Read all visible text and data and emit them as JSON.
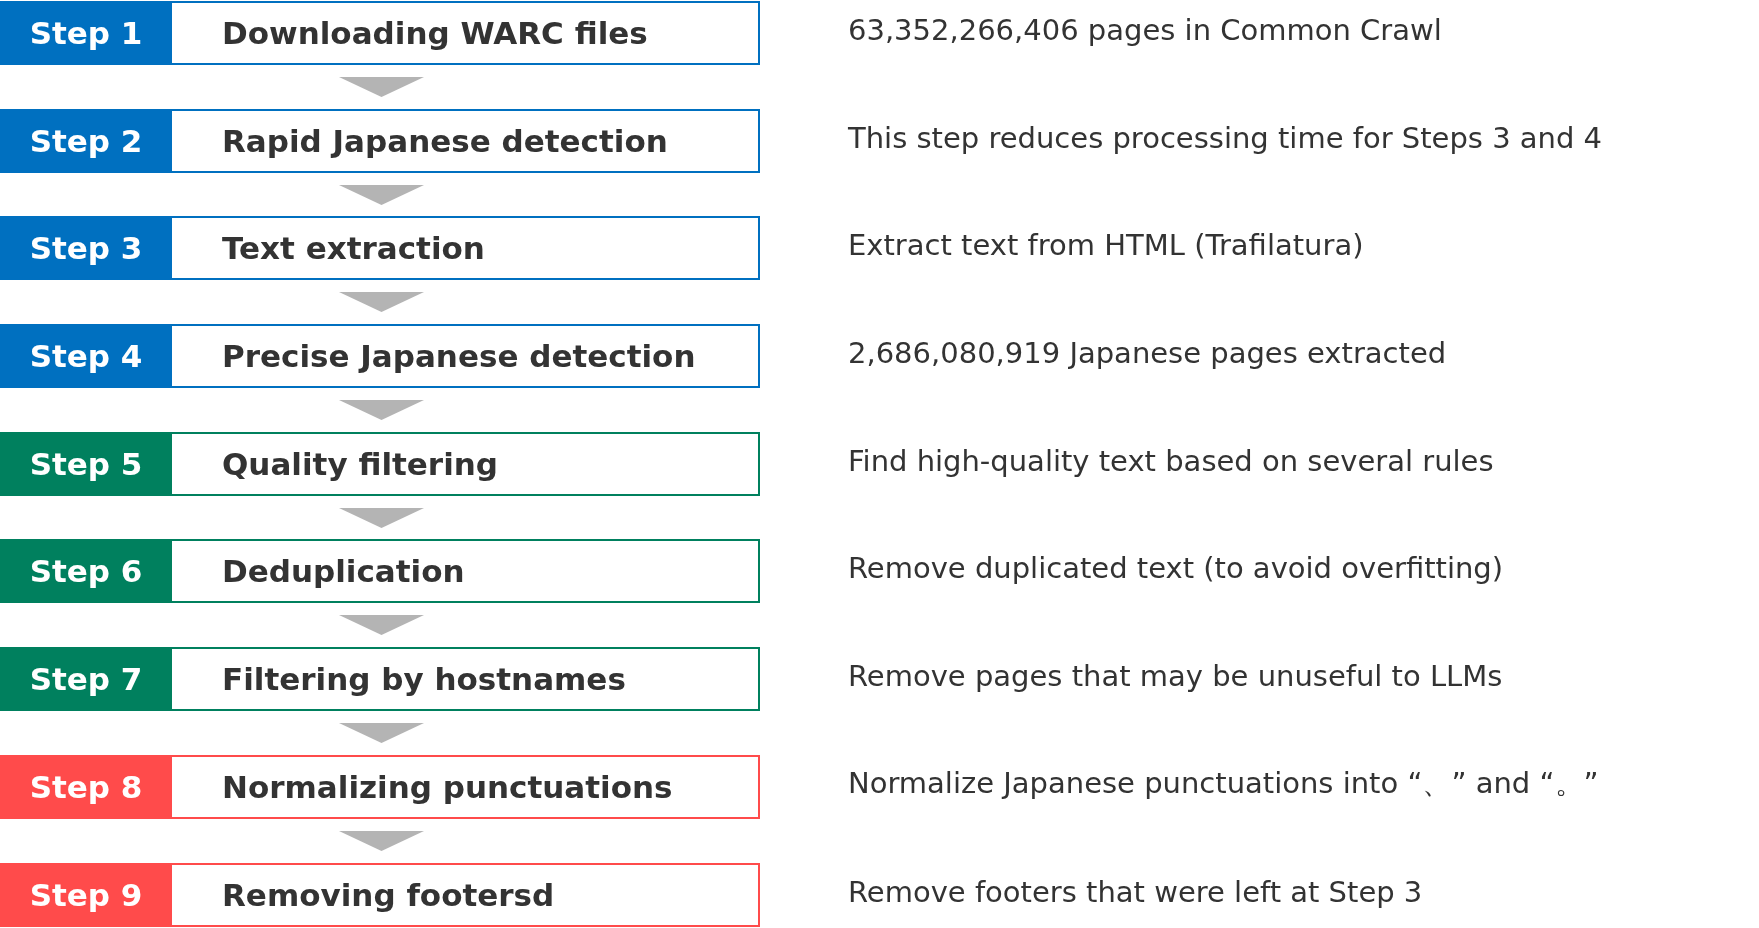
{
  "steps": [
    {
      "label": "Step 1",
      "title": "Downloading WARC files",
      "note": "63,352,266,406 pages in Common Crawl",
      "color": "#0070c0"
    },
    {
      "label": "Step 2",
      "title": "Rapid Japanese detection",
      "note": "This step reduces processing time for Steps 3 and 4",
      "color": "#0070c0"
    },
    {
      "label": "Step 3",
      "title": "Text extraction",
      "note": "Extract text from HTML (Trafilatura)",
      "color": "#0070c0"
    },
    {
      "label": "Step 4",
      "title": "Precise Japanese detection",
      "note": "2,686,080,919 Japanese pages extracted",
      "color": "#0070c0"
    },
    {
      "label": "Step 5",
      "title": "Quality filtering",
      "note": "Find high-quality text based on several rules",
      "color": "#00805e"
    },
    {
      "label": "Step 6",
      "title": "Deduplication",
      "note": "Remove duplicated text (to avoid overfitting)",
      "color": "#00805e"
    },
    {
      "label": "Step 7",
      "title": "Filtering by hostnames",
      "note": "Remove pages that may be unuseful to LLMs",
      "color": "#00805e"
    },
    {
      "label": "Step 8",
      "title": "Normalizing punctuations",
      "note": "Normalize Japanese punctuations into “、” and “。”",
      "color": "#ff4b4b"
    },
    {
      "label": "Step 9",
      "title": "Removing footersd",
      "note": "Remove footers that were left at Step 3",
      "color": "#ff4b4b"
    }
  ]
}
